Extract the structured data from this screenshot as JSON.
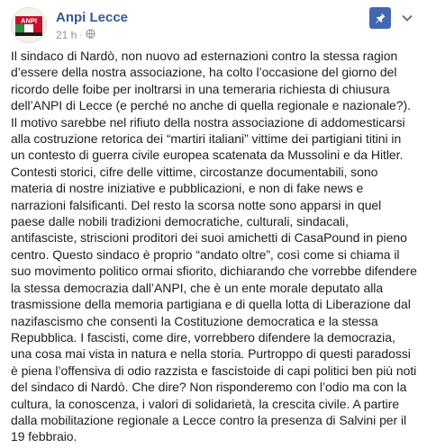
{
  "post": {
    "page_name": "Anpi Lecce",
    "time": "21 h",
    "separator": "·",
    "audience_icon": "globe-icon",
    "avatar_logo_text": "ANPI",
    "body": "Il sindaco di Nardò, non nuovo ad esternazioni contro la stessa ragion d’essere della nostra associazione, ha colto l’occasione del giorno del ricordo delle foibe per inoltrarsi in una temeraria richiesta di chiusura dell’ANPI di Lecce (e perché no anche di quella regionale e nazionale?). Il motivo sarebbe nel rifiuto della nostra associazione di addomesticarsi alla costruzione retorica dei “martiri italiani” vittime dei partigiani titini in un contesto di guerra civile europea scatenata da Mussolini e da Hitler. Contesti storici, cifre delle vittime, circostanze documentabili, sono materia di nostre iniziative e pubblicazioni, e non di fake news e narrazioni falsificanti. Del resto la scorsa notte sono apparsi in quel paese dalle nobili tradizioni democratiche, culturali, sindacali, antifasciste, striscioni proditori dei suoi amichetti di CasaPound in pieno centro. Questo sindaco è proprio “andato oltre”, così come si chiama il suo movimento politico ormai sfiorito, dichiarando che vorrebbe difendere la stessa democrazia dall’ANPI, che è un ente morale deputato alla trasmissione della memoria partigiana e di quella lotta di Liberazione dal nazifascismo che consentì la Costituzione democratica e la stessa Repubblica. I fascisti, come dire, vorrebbero difendere la democrazia, una cosa mai vista in natura e nella storia. Purtroppo di questi paradossi è piena l’offensiva di odio razzista e fascistoide di capi politici ben più noti del sindaco di Nardò. Che dire? Non risponderemo con l’odio ma con la cultura, la conoscenza, i valori di solidarietà, la crescita civile. A partire dalla mobilitazione regionale a Lecce contro la presenza di Salvini per il 19 febbraio."
  },
  "actions": {
    "pin_icon": "pin-icon",
    "more_icon": "chevron-down-icon"
  },
  "colors": {
    "name": "#365899",
    "meta": "#90949c",
    "pin_bg": "#4267b2",
    "avatar_red": "#c8102e",
    "avatar_green": "#2e8b3e"
  }
}
